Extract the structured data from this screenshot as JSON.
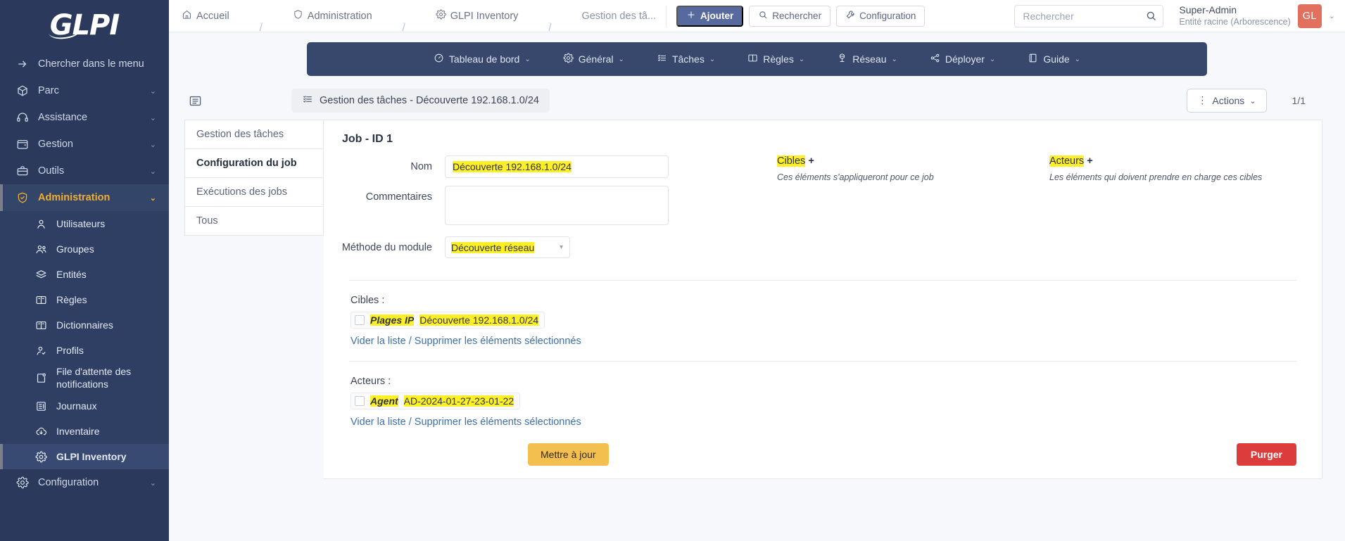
{
  "app": {
    "logo_text": "GLPI"
  },
  "sidebar": {
    "search_label": "Chercher dans le menu",
    "items": [
      {
        "label": "Parc",
        "icon": "box-icon"
      },
      {
        "label": "Assistance",
        "icon": "headset-icon"
      },
      {
        "label": "Gestion",
        "icon": "wallet-icon"
      },
      {
        "label": "Outils",
        "icon": "briefcase-icon"
      },
      {
        "label": "Administration",
        "icon": "shield-icon"
      }
    ],
    "submenu": [
      {
        "label": "Utilisateurs",
        "icon": "user-icon"
      },
      {
        "label": "Groupes",
        "icon": "users-icon"
      },
      {
        "label": "Entités",
        "icon": "layers-icon"
      },
      {
        "label": "Règles",
        "icon": "book-icon"
      },
      {
        "label": "Dictionnaires",
        "icon": "book-icon"
      },
      {
        "label": "Profils",
        "icon": "user-check-icon"
      },
      {
        "label": "File d'attente des notifications",
        "icon": "notification-icon"
      },
      {
        "label": "Journaux",
        "icon": "logs-icon"
      },
      {
        "label": "Inventaire",
        "icon": "cloud-download-icon"
      },
      {
        "label": "GLPI Inventory",
        "icon": "gear-icon"
      }
    ],
    "config": {
      "label": "Configuration",
      "icon": "gear-icon"
    }
  },
  "topbar": {
    "breadcrumb": [
      {
        "label": "Accueil",
        "icon": "home-icon"
      },
      {
        "label": "Administration",
        "icon": "shield-icon"
      },
      {
        "label": "GLPI Inventory",
        "icon": "gear-icon"
      },
      {
        "label": "Gestion des tâ...",
        "icon": ""
      }
    ],
    "add_label": "Ajouter",
    "search_label": "Rechercher",
    "config_label": "Configuration",
    "search_placeholder": "Rechercher",
    "user_name": "Super-Admin",
    "user_entity": "Entité racine (Arborescence)",
    "avatar_initials": "GL"
  },
  "modnav": {
    "items": [
      {
        "label": "Tableau de bord",
        "icon": "dashboard-icon"
      },
      {
        "label": "Général",
        "icon": "gear-icon"
      },
      {
        "label": "Tâches",
        "icon": "tasks-icon"
      },
      {
        "label": "Règles",
        "icon": "book-icon"
      },
      {
        "label": "Réseau",
        "icon": "network-icon"
      },
      {
        "label": "Déployer",
        "icon": "deploy-icon"
      },
      {
        "label": "Guide",
        "icon": "guide-icon"
      }
    ]
  },
  "ribbon": {
    "title": "Gestion des tâches - Découverte 192.168.1.0/24",
    "actions_label": "Actions",
    "pager": "1/1"
  },
  "vtabs": [
    {
      "label": "Gestion des tâches",
      "active": false
    },
    {
      "label": "Configuration du job",
      "active": true
    },
    {
      "label": "Exécutions des jobs",
      "active": false
    },
    {
      "label": "Tous",
      "active": false
    }
  ],
  "form": {
    "card_title": "Job - ID 1",
    "name_label": "Nom",
    "name_value": "Découverte 192.168.1.0/24",
    "comments_label": "Commentaires",
    "comments_value": "",
    "method_label": "Méthode du module",
    "method_value": "Découverte réseau",
    "targets_heading": "Cibles",
    "targets_plus": "+",
    "targets_desc": "Ces éléments s'appliqueront pour ce job",
    "actors_heading": "Acteurs",
    "actors_plus": "+",
    "actors_desc": "Les éléments qui doivent prendre en charge ces cibles",
    "targets_block_label": "Cibles :",
    "targets_item_type": "Plages IP",
    "targets_item_value": "Découverte 192.168.1.0/24",
    "targets_links": "Vider la liste / Supprimer les éléments sélectionnés",
    "actors_block_label": "Acteurs :",
    "actors_item_type": "Agent",
    "actors_item_value": "AD-2024-01-27-23-01-22",
    "actors_links": "Vider la liste / Supprimer les éléments sélectionnés",
    "update_label": "Mettre à jour",
    "purge_label": "Purger"
  },
  "colors": {
    "sidebar_bg": "#2b3a5c",
    "accent_yellow": "#f0ad2e",
    "highlight": "#ffef26",
    "primary_button": "#566a9e",
    "update_button": "#f3c04f",
    "purge_button": "#dc3c3c",
    "avatar": "#e2705f"
  }
}
